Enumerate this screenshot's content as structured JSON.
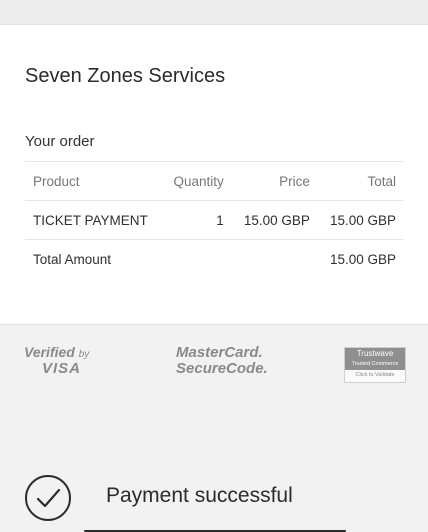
{
  "merchant_name": "Seven Zones Services",
  "order": {
    "title": "Your order",
    "headers": {
      "product": "Product",
      "quantity": "Quantity",
      "price": "Price",
      "total": "Total"
    },
    "items": [
      {
        "product": "TICKET PAYMENT",
        "quantity": "1",
        "price": "15.00 GBP",
        "total": "15.00 GBP"
      }
    ],
    "total_label": "Total Amount",
    "total_value": "15.00 GBP"
  },
  "brands": {
    "visa": {
      "line1": "Verified",
      "by": "by",
      "line2": "VISA"
    },
    "mastercard": {
      "line1": "MasterCard.",
      "line2": "SecureCode."
    },
    "trustwave": {
      "name": "Trustwave",
      "sub": "Trusted Commerce",
      "action": "Click to Validate"
    }
  },
  "status": {
    "text": "Payment successful",
    "icon": "check-circle-icon"
  }
}
